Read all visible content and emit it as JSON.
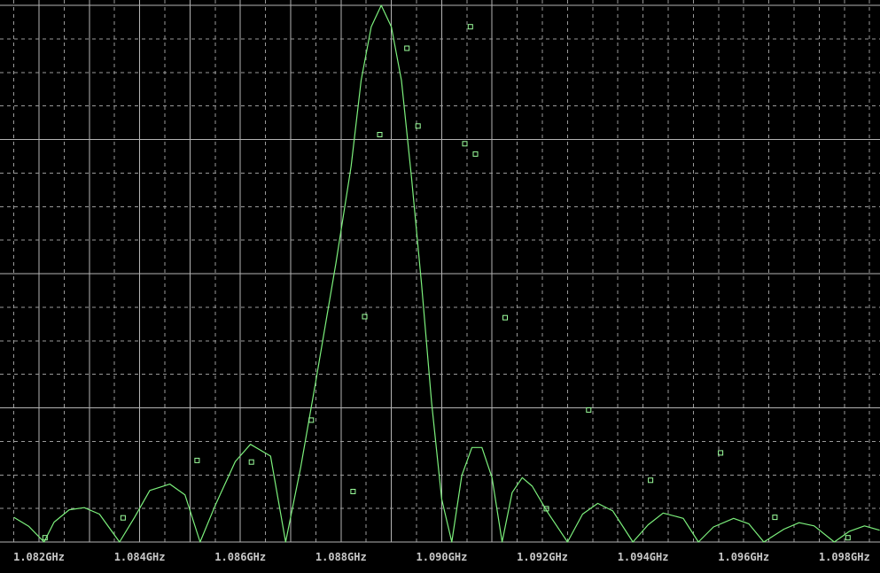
{
  "colors": {
    "background": "#000000",
    "grid_major": "#b4b4b4",
    "grid_minor": "#9a9a9a",
    "trace": "#7cf07c",
    "marker": "#9cff9c",
    "tick_label": "#c8c8c8"
  },
  "chart_data": {
    "type": "line",
    "title": "",
    "xlabel": "",
    "ylabel": "",
    "x_unit": "GHz",
    "xlim": [
      1.0815,
      1.0987
    ],
    "ylim": [
      0,
      1.0
    ],
    "grid": true,
    "x_ticks": [
      1.082,
      1.084,
      1.086,
      1.088,
      1.09,
      1.092,
      1.094,
      1.096,
      1.098
    ],
    "x_tick_labels": [
      "1.082GHz",
      "1.084GHz",
      "1.086GHz",
      "1.088GHz",
      "1.090GHz",
      "1.092GHz",
      "1.094GHz",
      "1.096GHz",
      "1.098GHz"
    ],
    "series": [
      {
        "x": [
          1.0815,
          1.0818,
          1.0821,
          1.0823,
          1.0826,
          1.0829,
          1.0832,
          1.0836,
          1.0839,
          1.0842,
          1.0846,
          1.0849,
          1.0852,
          1.0855,
          1.0859,
          1.0862,
          1.0866,
          1.0869,
          1.0872,
          1.0875,
          1.0879,
          1.0882,
          1.0884,
          1.0886,
          1.0888,
          1.089,
          1.0892,
          1.0894,
          1.0896,
          1.0898,
          1.09,
          1.0902,
          1.0904,
          1.0906,
          1.0908,
          1.091,
          1.0912,
          1.0914,
          1.0916,
          1.0918,
          1.0921,
          1.0925,
          1.0928,
          1.0931,
          1.0934,
          1.0938,
          1.0941,
          1.0944,
          1.0948,
          1.0951,
          1.0954,
          1.0958,
          1.0961,
          1.0964,
          1.0968,
          1.0971,
          1.0974,
          1.0978,
          1.0981,
          1.0984,
          1.0987
        ],
        "y": [
          0.046,
          0.029,
          0.0,
          0.037,
          0.06,
          0.064,
          0.052,
          0.0,
          0.046,
          0.096,
          0.108,
          0.088,
          0.0,
          0.068,
          0.15,
          0.182,
          0.16,
          0.0,
          0.14,
          0.3,
          0.52,
          0.7,
          0.86,
          0.96,
          1.0,
          0.96,
          0.86,
          0.68,
          0.48,
          0.26,
          0.08,
          0.0,
          0.124,
          0.176,
          0.176,
          0.12,
          0.0,
          0.092,
          0.12,
          0.104,
          0.056,
          0.0,
          0.052,
          0.072,
          0.058,
          0.0,
          0.032,
          0.054,
          0.044,
          0.0,
          0.028,
          0.044,
          0.034,
          0.0,
          0.024,
          0.036,
          0.03,
          0.0,
          0.02,
          0.03,
          0.022
        ]
      }
    ],
    "markers": [
      {
        "x": 1.08212,
        "y": 0.008
      },
      {
        "x": 1.08367,
        "y": 0.045
      },
      {
        "x": 1.08514,
        "y": 0.152
      },
      {
        "x": 1.08622,
        "y": 0.149
      },
      {
        "x": 1.08741,
        "y": 0.227
      },
      {
        "x": 1.08824,
        "y": 0.094
      },
      {
        "x": 1.08847,
        "y": 0.42
      },
      {
        "x": 1.08877,
        "y": 0.759
      },
      {
        "x": 1.08931,
        "y": 0.92
      },
      {
        "x": 1.08953,
        "y": 0.775
      },
      {
        "x": 1.09046,
        "y": 0.742
      },
      {
        "x": 1.09057,
        "y": 0.96
      },
      {
        "x": 1.09067,
        "y": 0.723
      },
      {
        "x": 1.09126,
        "y": 0.418
      },
      {
        "x": 1.09208,
        "y": 0.062
      },
      {
        "x": 1.09292,
        "y": 0.246
      },
      {
        "x": 1.09415,
        "y": 0.115
      },
      {
        "x": 1.09554,
        "y": 0.166
      },
      {
        "x": 1.09662,
        "y": 0.046
      },
      {
        "x": 1.09807,
        "y": 0.008
      }
    ]
  }
}
